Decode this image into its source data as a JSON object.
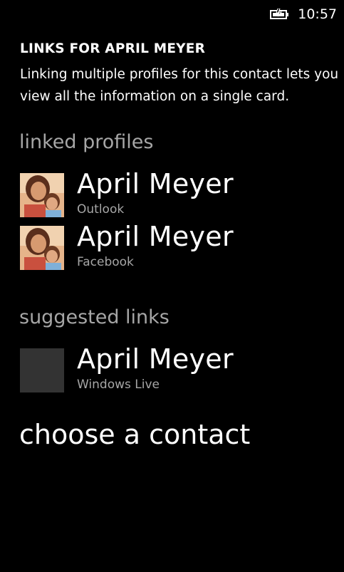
{
  "status_bar": {
    "time": "10:57",
    "battery_icon": "battery-charging-icon"
  },
  "header": {
    "title": "LINKS FOR APRIL MEYER",
    "description": "Linking multiple profiles for this contact lets you view all the information on a single card."
  },
  "linked_profiles": {
    "heading": "linked profiles",
    "items": [
      {
        "name": "April Meyer",
        "source": "Outlook",
        "avatar": "photo"
      },
      {
        "name": "April Meyer",
        "source": "Facebook",
        "avatar": "photo"
      }
    ]
  },
  "suggested_links": {
    "heading": "suggested links",
    "items": [
      {
        "name": "April Meyer",
        "source": "Windows Live",
        "avatar": "placeholder"
      }
    ]
  },
  "actions": {
    "choose_contact": "choose a contact"
  },
  "colors": {
    "background": "#000000",
    "text": "#ffffff",
    "subtle_text": "#a6a6a6",
    "placeholder_tile": "#333333"
  }
}
